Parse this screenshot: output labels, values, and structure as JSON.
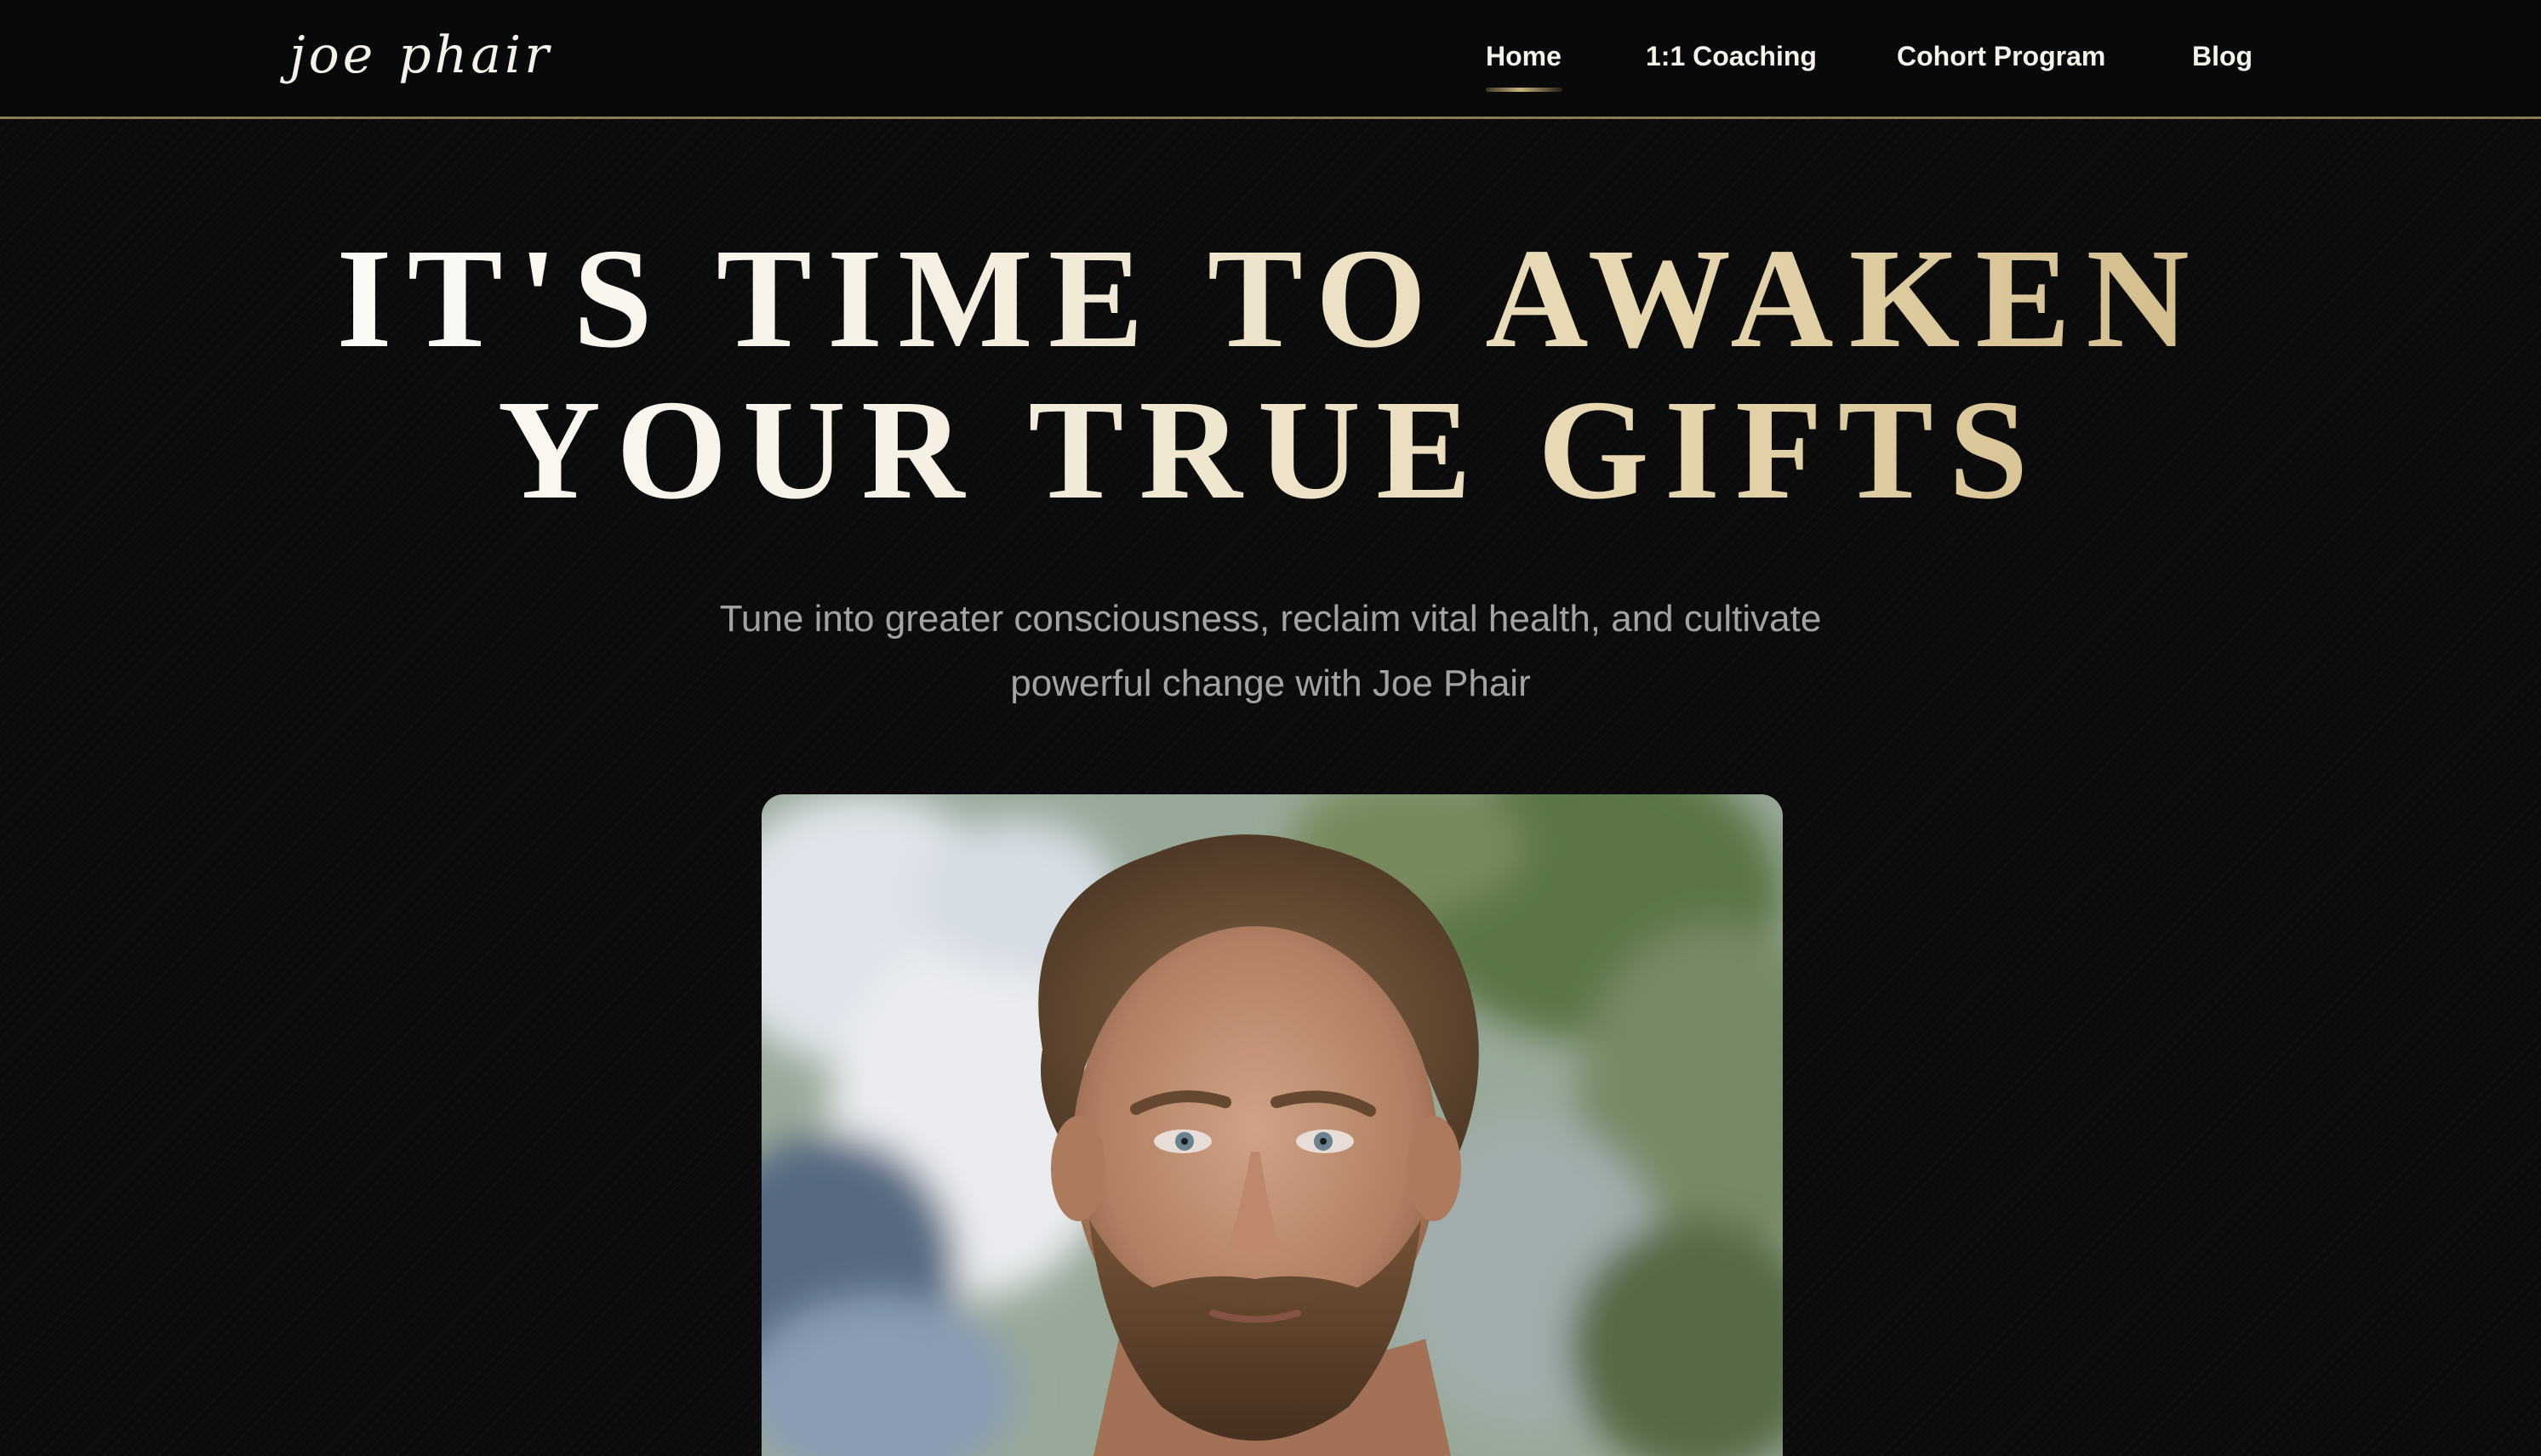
{
  "header": {
    "logo_text_1": "joe",
    "logo_text_2": "phair",
    "nav": {
      "home": "Home",
      "coaching": "1:1 Coaching",
      "cohort": "Cohort Program",
      "blog": "Blog"
    },
    "active_item": "Home"
  },
  "hero": {
    "title_line_1": "IT'S TIME TO AWAKEN",
    "title_line_2": "YOUR TRUE GIFTS",
    "subtitle_line_1": "Tune into greater consciousness, reclaim vital health, and cultivate",
    "subtitle_line_2": "powerful change with Joe Phair"
  },
  "colors": {
    "background": "#0b0b0b",
    "accent_gold": "#c9b27a",
    "nav_text": "#f5f2ec",
    "subtitle": "#a3a3a3"
  }
}
